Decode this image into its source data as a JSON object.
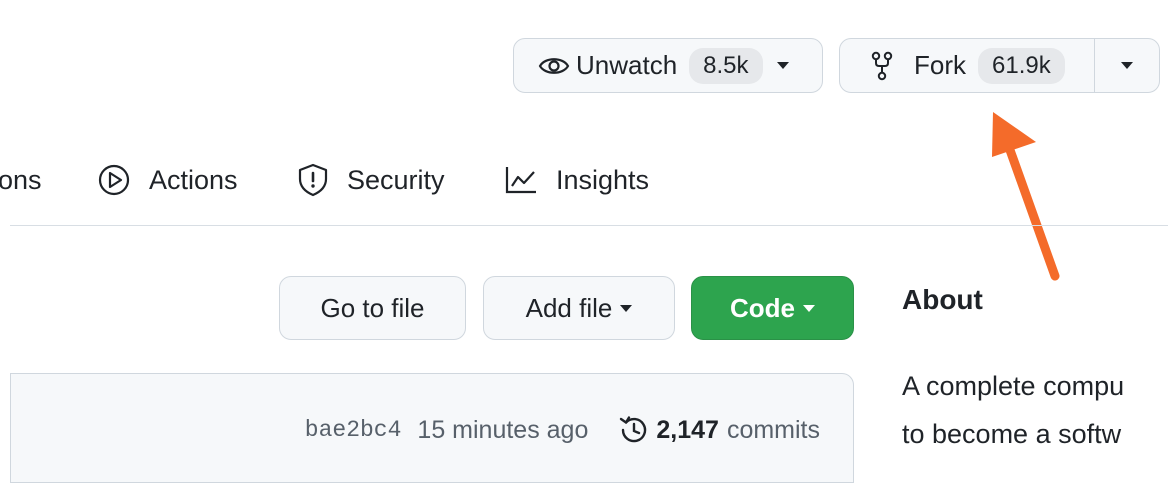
{
  "header": {
    "unwatch": {
      "label": "Unwatch",
      "count": "8.5k"
    },
    "fork": {
      "label": "Fork",
      "count": "61.9k"
    }
  },
  "tabs": {
    "partial": "ons",
    "actions": "Actions",
    "security": "Security",
    "insights": "Insights"
  },
  "toolbar": {
    "go_to_file": "Go to file",
    "add_file": "Add file",
    "code": "Code"
  },
  "commit": {
    "hash": "bae2bc4",
    "time": "15 minutes ago",
    "count": "2,147",
    "label": "commits"
  },
  "about": {
    "heading": "About",
    "line1": "A complete compu",
    "line2": "to become a softw"
  },
  "colors": {
    "accent_arrow": "#f46b2a",
    "code_green": "#2da44e"
  }
}
